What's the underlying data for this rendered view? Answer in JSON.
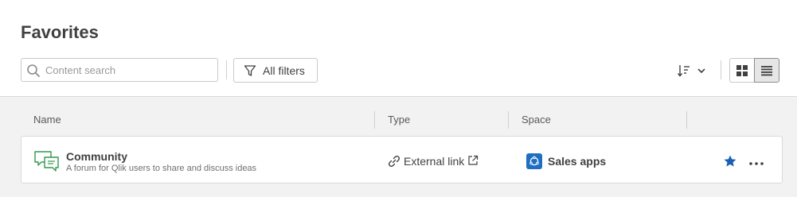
{
  "page": {
    "title": "Favorites"
  },
  "toolbar": {
    "search_placeholder": "Content search",
    "filters_label": "All filters",
    "sort_icon": "sort-descending-icon",
    "view_modes": [
      "grid",
      "list"
    ],
    "active_view": "list"
  },
  "table": {
    "columns": [
      "Name",
      "Type",
      "Space"
    ],
    "rows": [
      {
        "name": "Community",
        "description": "A forum for Qlik users to share and discuss ideas",
        "icon": "chat-bubbles-icon",
        "type": "External link",
        "space": "Sales apps",
        "favorited": true
      }
    ]
  },
  "colors": {
    "accent_blue": "#1f6fc1",
    "star_blue": "#1a5fb4",
    "community_icon_green": "#2e9a4a",
    "content_bg": "#f2f2f2"
  }
}
